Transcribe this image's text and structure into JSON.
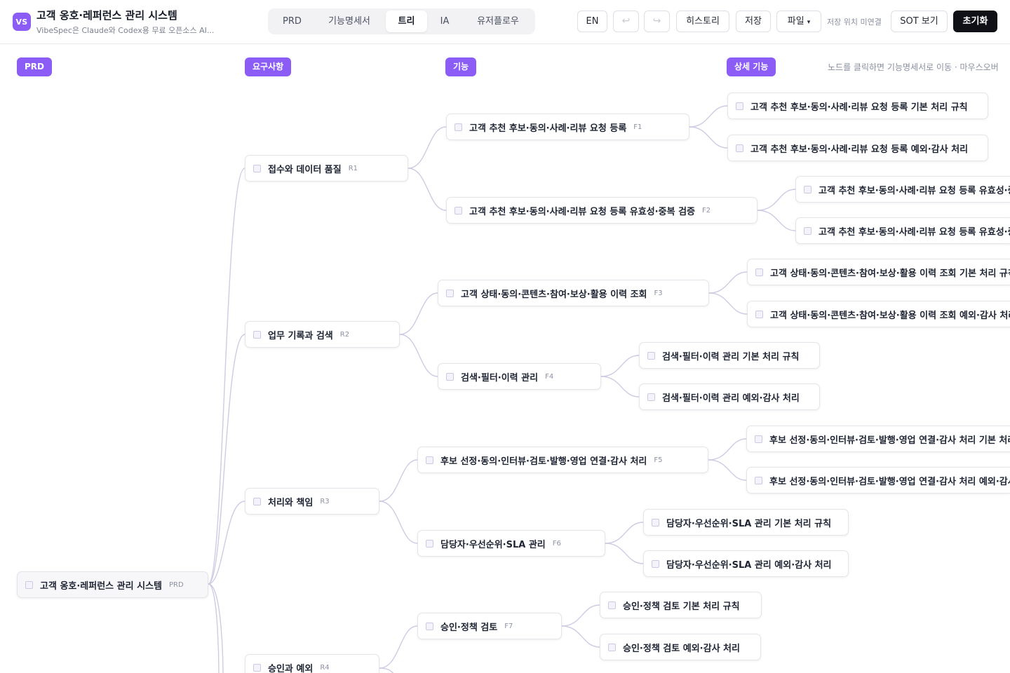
{
  "header": {
    "logo": "VS",
    "title": "고객 옹호·레퍼런스 관리 시스템",
    "subtitle": "VibeSpec은 Claude와 Codex용 무료 오픈소스 AI...",
    "tabs": [
      "PRD",
      "기능명세서",
      "트리",
      "IA",
      "유저플로우"
    ],
    "active_tab": "트리",
    "lang_button": "EN",
    "undo_icon": "↩",
    "redo_icon": "↪",
    "history_button": "히스토리",
    "save_button": "저장",
    "file_button": "파일",
    "file_caret": "▾",
    "save_location": "저장 위치 미연결",
    "sot_button": "SOT 보기",
    "reset_button": "초기화"
  },
  "columns": {
    "prd": "PRD",
    "requirements": "요구사항",
    "features": "기능",
    "details": "상세 기능"
  },
  "hint": "노드를 클릭하면 기능명세서로 이동 · 마우스오버",
  "tree": {
    "root": {
      "label": "고객 옹호·레퍼런스 관리 시스템",
      "code": "PRD"
    },
    "requirements": [
      {
        "label": "접수와 데이터 품질",
        "code": "R1"
      },
      {
        "label": "업무 기록과 검색",
        "code": "R2"
      },
      {
        "label": "처리와 책임",
        "code": "R3"
      },
      {
        "label": "승인과 예외",
        "code": "R4"
      }
    ],
    "features": [
      {
        "label": "고객 추천 후보·동의·사례·리뷰 요청 등록",
        "code": "F1"
      },
      {
        "label": "고객 추천 후보·동의·사례·리뷰 요청 등록 유효성·중복 검증",
        "code": "F2"
      },
      {
        "label": "고객 상태·동의·콘텐츠·참여·보상·활용 이력 조회",
        "code": "F3"
      },
      {
        "label": "검색·필터·이력 관리",
        "code": "F4"
      },
      {
        "label": "후보 선정·동의·인터뷰·검토·발행·영업 연결·감사 처리",
        "code": "F5"
      },
      {
        "label": "담당자·우선순위·SLA 관리",
        "code": "F6"
      },
      {
        "label": "승인·정책 검토",
        "code": "F7"
      }
    ],
    "details": [
      {
        "label": "고객 추천 후보·동의·사례·리뷰 요청 등록 기본 처리 규칙"
      },
      {
        "label": "고객 추천 후보·동의·사례·리뷰 요청 등록 예외·감사 처리"
      },
      {
        "label": "고객 추천 후보·동의·사례·리뷰 요청 등록 유효성·중복 검증 기본 처리 규칙"
      },
      {
        "label": "고객 추천 후보·동의·사례·리뷰 요청 등록 유효성·중복 검증 예외·감사 처리"
      },
      {
        "label": "고객 상태·동의·콘텐츠·참여·보상·활용 이력 조회 기본 처리 규칙"
      },
      {
        "label": "고객 상태·동의·콘텐츠·참여·보상·활용 이력 조회 예외·감사 처리"
      },
      {
        "label": "검색·필터·이력 관리 기본 처리 규칙"
      },
      {
        "label": "검색·필터·이력 관리 예외·감사 처리"
      },
      {
        "label": "후보 선정·동의·인터뷰·검토·발행·영업 연결·감사 처리 기본 처리 규칙"
      },
      {
        "label": "후보 선정·동의·인터뷰·검토·발행·영업 연결·감사 처리 예외·감사 처리"
      },
      {
        "label": "담당자·우선순위·SLA 관리 기본 처리 규칙"
      },
      {
        "label": "담당자·우선순위·SLA 관리 예외·감사 처리"
      },
      {
        "label": "승인·정책 검토 기본 처리 규칙"
      },
      {
        "label": "승인·정책 검토 예외·감사 처리"
      }
    ]
  }
}
